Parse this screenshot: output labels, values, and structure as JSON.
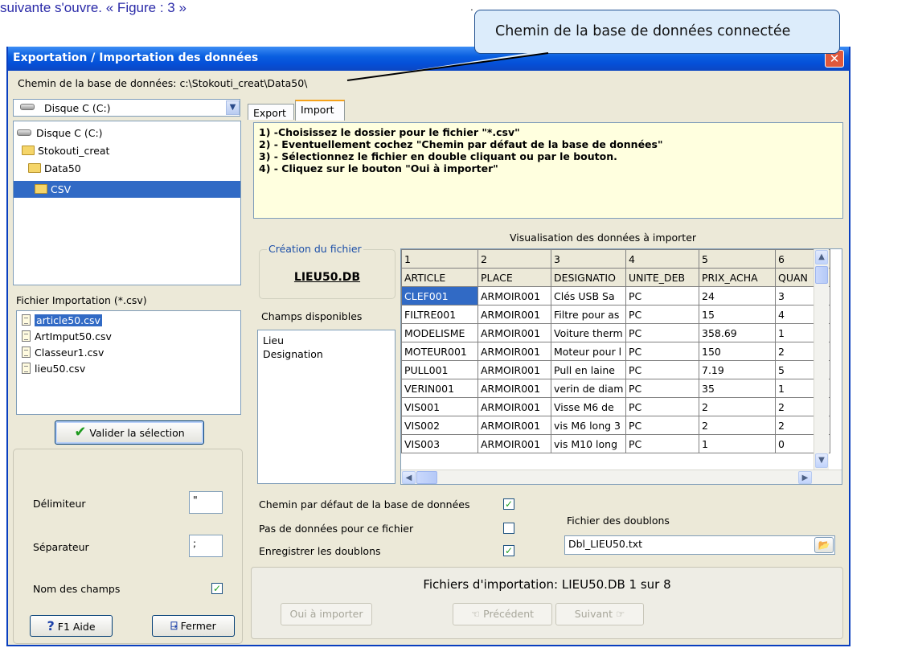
{
  "doc_caption": "suivante s'ouvre. « Figure : 3 »",
  "doc_dot": ".",
  "callout": "Chemin de la base de données connectée",
  "window": {
    "title": "Exportation / Importation des données",
    "close_glyph": "✕",
    "path_label": "Chemin de la base de données: c:\\Stokouti_creat\\Data50\\"
  },
  "drive_combo": {
    "value": "Disque C (C:)",
    "arrow": "▼"
  },
  "folder_tree": [
    {
      "label": "Disque C (C:)",
      "icon": "disk-icon"
    },
    {
      "label": "Stokouti_creat",
      "icon": "folder-icon"
    },
    {
      "label": "Data50",
      "icon": "folder-icon"
    },
    {
      "label": "CSV",
      "icon": "folder-open-icon",
      "selected": true
    }
  ],
  "file_list": {
    "label": "Fichier Importation (*.csv)",
    "items": [
      "article50.csv",
      "ArtImput50.csv",
      "Classeur1.csv",
      "lieu50.csv"
    ],
    "selected": "article50.csv"
  },
  "validate_button": "Valider la sélection",
  "options": {
    "delimiter_label": "Délimiteur",
    "delimiter_value": "\"",
    "separator_label": "Séparateur",
    "separator_value": ";",
    "field_names_label": "Nom des champs",
    "field_names_checked": "✓"
  },
  "help_button": "F1 Aide",
  "close_button": "Fermer",
  "tabs": [
    "Export",
    "Import"
  ],
  "active_tab": "Import",
  "instructions": [
    "1) -Choisissez le dossier pour le fichier \"*.csv\"",
    "2) - Eventuellement cochez \"Chemin par défaut de la base de données\"",
    "3) - Sélectionnez le fichier en double cliquant ou par le bouton.",
    "4) - Cliquez sur le bouton \"Oui à importer\""
  ],
  "file_creation": {
    "label": "Création du fichier",
    "value": "LIEU50.DB"
  },
  "available_fields": {
    "label": "Champs disponibles",
    "items": [
      "Lieu",
      "Designation"
    ]
  },
  "preview": {
    "title": "Visualisation des données à importer",
    "col_numbers": [
      "1",
      "2",
      "3",
      "4",
      "5",
      "6"
    ],
    "headers": [
      "ARTICLE",
      "PLACE",
      "DESIGNATIO",
      "UNITE_DEB",
      "PRIX_ACHA",
      "QUAN"
    ],
    "rows": [
      [
        "CLEF001",
        "ARMOIR001",
        "Clés USB Sa",
        "PC",
        "24",
        "3"
      ],
      [
        "FILTRE001",
        "ARMOIR001",
        "Filtre pour as",
        "PC",
        "15",
        "4"
      ],
      [
        "MODELISME",
        "ARMOIR001",
        "Voiture therm",
        "PC",
        "358.69",
        "1"
      ],
      [
        "MOTEUR001",
        "ARMOIR001",
        "Moteur pour l",
        "PC",
        "150",
        "2"
      ],
      [
        "PULL001",
        "ARMOIR001",
        "Pull en laine",
        "PC",
        "7.19",
        "5"
      ],
      [
        "VERIN001",
        "ARMOIR001",
        "verin de diam",
        "PC",
        "35",
        "1"
      ],
      [
        "VIS001",
        "ARMOIR001",
        "Visse M6 de",
        "PC",
        "2",
        "2"
      ],
      [
        "VIS002",
        "ARMOIR001",
        "vis M6 long 3",
        "PC",
        "2",
        "2"
      ],
      [
        "VIS003",
        "ARMOIR001",
        "vis M10 long",
        "PC",
        "1",
        "0"
      ]
    ]
  },
  "checks": {
    "default_path": {
      "label": "Chemin par défaut de la base de données",
      "checked": "✓"
    },
    "no_data": {
      "label": "Pas de données pour ce fichier",
      "checked": ""
    },
    "save_duplicates": {
      "label": "Enregistrer les doublons",
      "checked": "✓"
    }
  },
  "duplicates_file": {
    "label": "Fichier des doublons",
    "value": "Dbl_LIEU50.txt"
  },
  "status": "Fichiers d'importation: LIEU50.DB  1 sur 8",
  "buttons": {
    "import": "Oui à importer",
    "previous": "Précédent",
    "next": "Suivant"
  }
}
